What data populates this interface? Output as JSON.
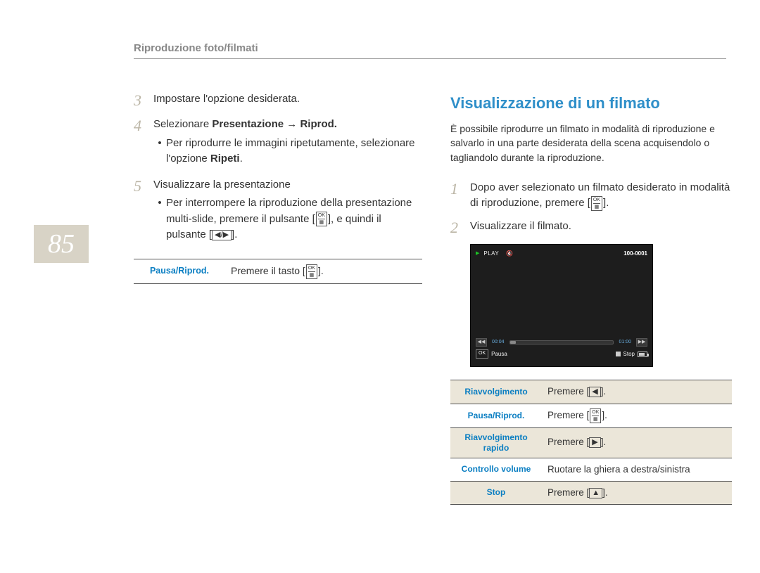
{
  "section_title": "Riproduzione foto/filmati",
  "page_number": "85",
  "left": {
    "step3": {
      "num": "3",
      "text": "Impostare l'opzione desiderata."
    },
    "step4": {
      "num": "4",
      "prefix": "Selezionare ",
      "bold1": "Presentazione",
      "arrow": " → ",
      "bold2": "Riprod.",
      "bullet_prefix": "Per riprodurre le immagini ripetutamente, selezionare l'opzione ",
      "bullet_bold": "Ripeti",
      "bullet_dot": "."
    },
    "step5": {
      "num": "5",
      "text": "Visualizzare la presentazione",
      "bullet_full_pre": "Per interrompere la riproduzione della presentazione multi-slide, premere il pulsante [",
      "bullet_mid": "], e quindi il pulsante ["
    },
    "table": {
      "label": "Pausa/Riprod.",
      "action_pre": "Premere il tasto ["
    }
  },
  "right": {
    "heading": "Visualizzazione di un ﬁlmato",
    "intro": "È possibile riprodurre un ﬁlmato in modalità di riproduzione e salvarlo in una parte desiderata della scena acquisendolo o tagliandolo durante la riproduzione.",
    "step1": {
      "num": "1",
      "text_pre": "Dopo aver selezionato un ﬁlmato desiderato in modalità di riproduzione, premere ["
    },
    "step2": {
      "num": "2",
      "text": "Visualizzare il ﬁlmato."
    },
    "display": {
      "play_label": "PLAY",
      "file_id": "100-0001",
      "time_cur": "00:04",
      "time_tot": "01:00",
      "ok_label": "OK",
      "pausa": "Pausa",
      "stop": "Stop"
    },
    "controls": {
      "rows": [
        {
          "label": "Riavvolgimento",
          "action_pre": "Premere [",
          "glyph": "◀"
        },
        {
          "label": "Pausa/Riprod.",
          "action_pre": "Premere [",
          "glyph": "OK"
        },
        {
          "label": "Riavvolgimento rapido",
          "action_pre": "Premere [",
          "glyph": "▶"
        },
        {
          "label": "Controllo volume",
          "action_text": "Ruotare la ghiera a destra/sinistra"
        },
        {
          "label": "Stop",
          "action_pre": "Premere [",
          "glyph": "▲"
        }
      ]
    }
  },
  "icons": {
    "ok_top": "OK",
    "ok_bot": "▦",
    "left_right": "◀/▶",
    "bracket_close": "]."
  }
}
